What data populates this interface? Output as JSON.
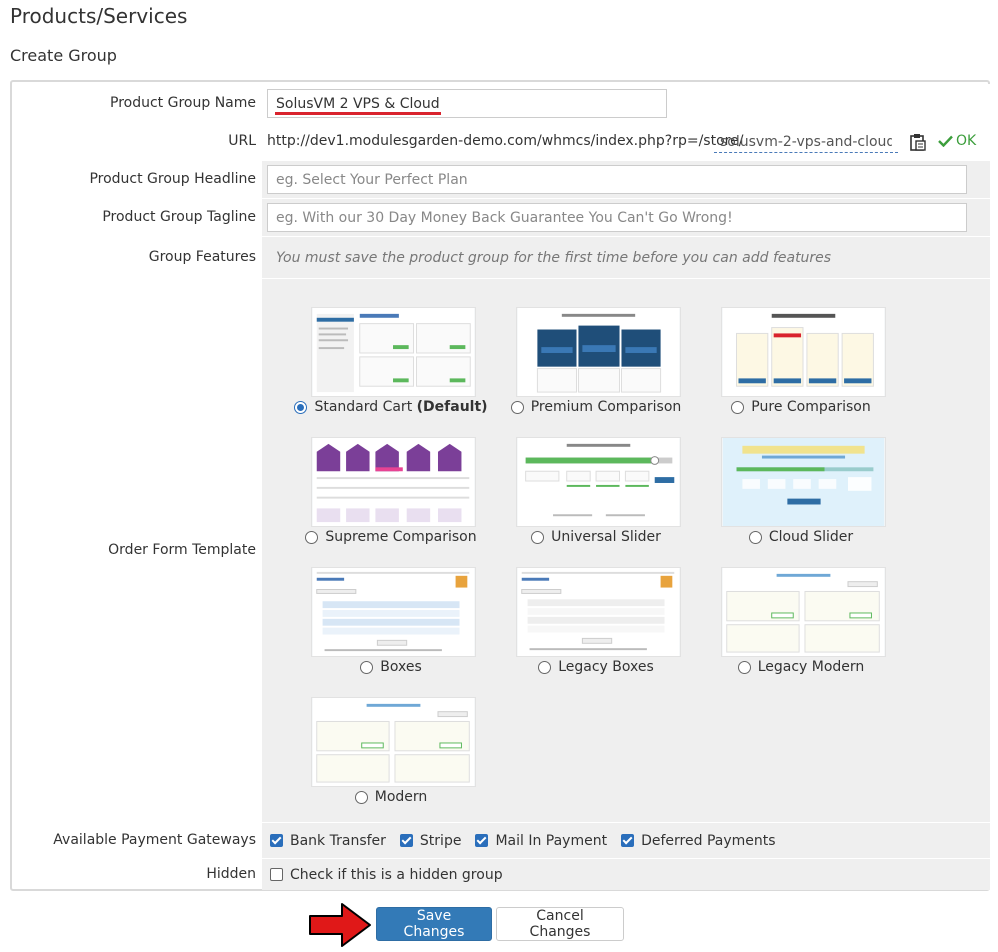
{
  "page": {
    "title": "Products/Services",
    "subtitle": "Create Group"
  },
  "form": {
    "product_group_name": {
      "label": "Product Group Name",
      "value": "SolusVM 2 VPS & Cloud"
    },
    "url": {
      "label": "URL",
      "base": "http://dev1.modulesgarden-demo.com/whmcs/index.php?rp=/store/",
      "slug": "solusvm-2-vps-and-cloud",
      "status": "OK",
      "copy_icon": "clipboard-icon",
      "status_icon": "check-icon"
    },
    "headline": {
      "label": "Product Group Headline",
      "placeholder": "eg. Select Your Perfect Plan"
    },
    "tagline": {
      "label": "Product Group Tagline",
      "placeholder": "eg. With our 30 Day Money Back Guarantee You Can't Go Wrong!"
    },
    "features": {
      "label": "Group Features",
      "note": "You must save the product group for the first time before you can add features"
    },
    "order_form": {
      "label": "Order Form Template",
      "templates": [
        {
          "name": "Standard Cart",
          "suffix": "(Default)",
          "selected": true
        },
        {
          "name": "Premium Comparison",
          "suffix": "",
          "selected": false
        },
        {
          "name": "Pure Comparison",
          "suffix": "",
          "selected": false
        },
        {
          "name": "Supreme Comparison",
          "suffix": "",
          "selected": false
        },
        {
          "name": "Universal Slider",
          "suffix": "",
          "selected": false
        },
        {
          "name": "Cloud Slider",
          "suffix": "",
          "selected": false
        },
        {
          "name": "Boxes",
          "suffix": "",
          "selected": false
        },
        {
          "name": "Legacy Boxes",
          "suffix": "",
          "selected": false
        },
        {
          "name": "Legacy Modern",
          "suffix": "",
          "selected": false
        },
        {
          "name": "Modern",
          "suffix": "",
          "selected": false
        }
      ]
    },
    "gateways": {
      "label": "Available Payment Gateways",
      "items": [
        {
          "name": "Bank Transfer",
          "checked": true
        },
        {
          "name": "Stripe",
          "checked": true
        },
        {
          "name": "Mail In Payment",
          "checked": true
        },
        {
          "name": "Deferred Payments",
          "checked": true
        }
      ]
    },
    "hidden": {
      "label": "Hidden",
      "option": "Check if this is a hidden group",
      "checked": false
    }
  },
  "buttons": {
    "save": "Save Changes",
    "cancel": "Cancel Changes"
  },
  "colors": {
    "primary": "#337ab7",
    "annotation_red": "#d9232d",
    "ok_green": "#3c9e3c",
    "field_bg": "#efefef"
  }
}
